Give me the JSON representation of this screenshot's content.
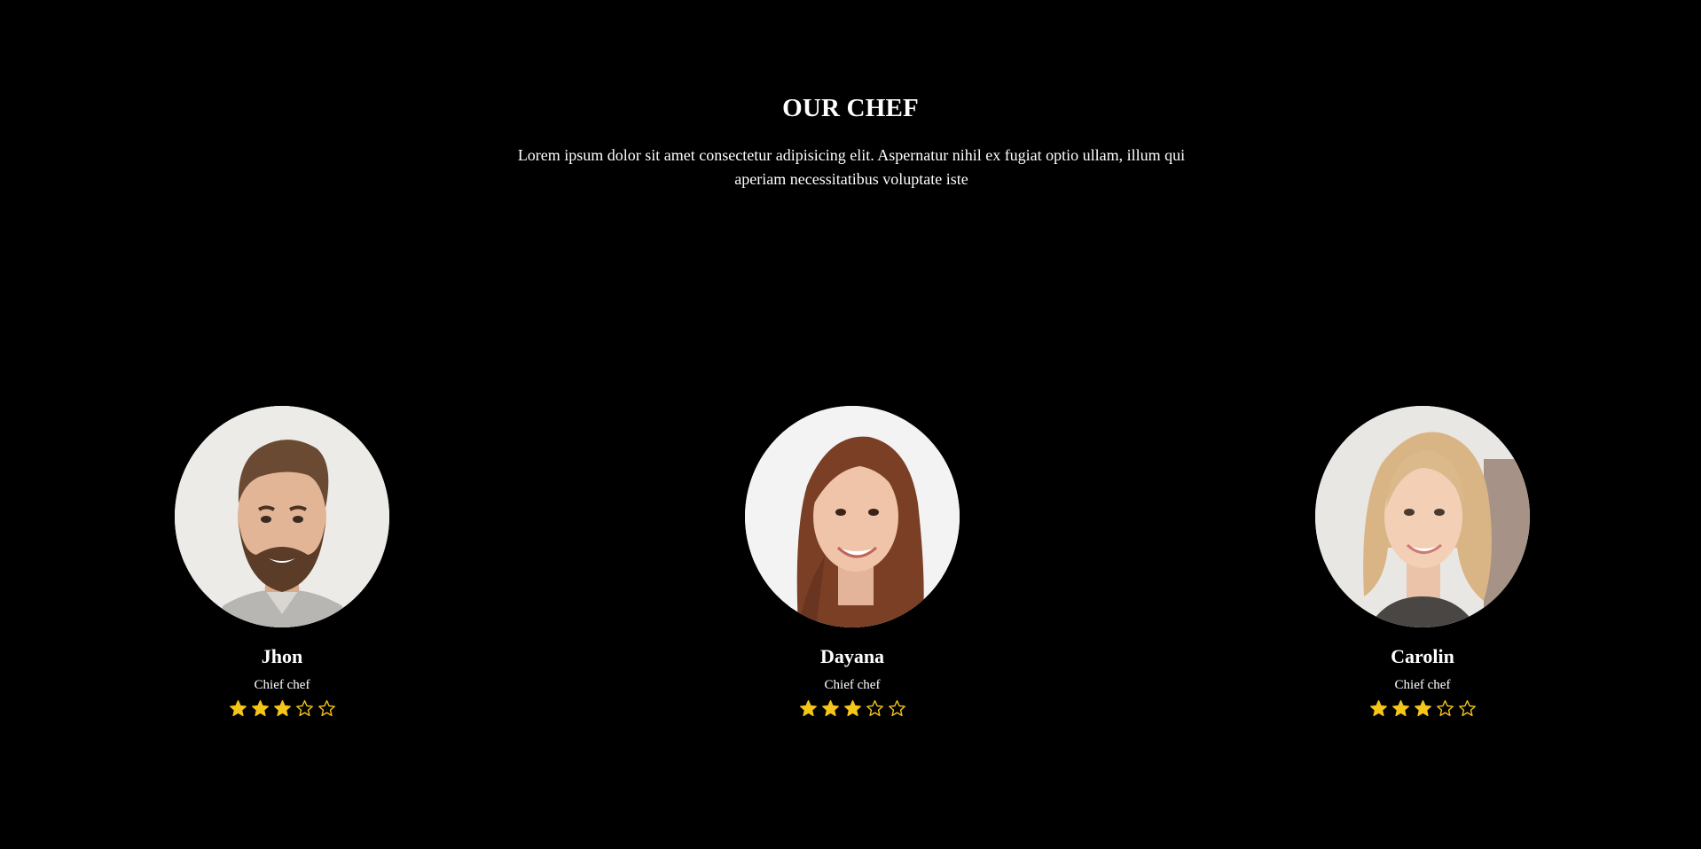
{
  "section": {
    "title": "OUR CHEF",
    "description": "Lorem ipsum dolor sit amet consectetur adipisicing elit. Aspernatur nihil ex fugiat optio ullam, illum qui aperiam necessitatibus voluptate iste"
  },
  "colors": {
    "background": "#000000",
    "text": "#ffffff",
    "star": "#f5c518"
  },
  "chefs": [
    {
      "name": "Jhon",
      "role": "Chief chef",
      "rating": 3,
      "max_rating": 5,
      "photo": "man-bearded-portrait"
    },
    {
      "name": "Dayana",
      "role": "Chief chef",
      "rating": 3,
      "max_rating": 5,
      "photo": "woman-brunette-portrait"
    },
    {
      "name": "Carolin",
      "role": "Chief chef",
      "rating": 3,
      "max_rating": 5,
      "photo": "woman-blonde-portrait"
    }
  ]
}
